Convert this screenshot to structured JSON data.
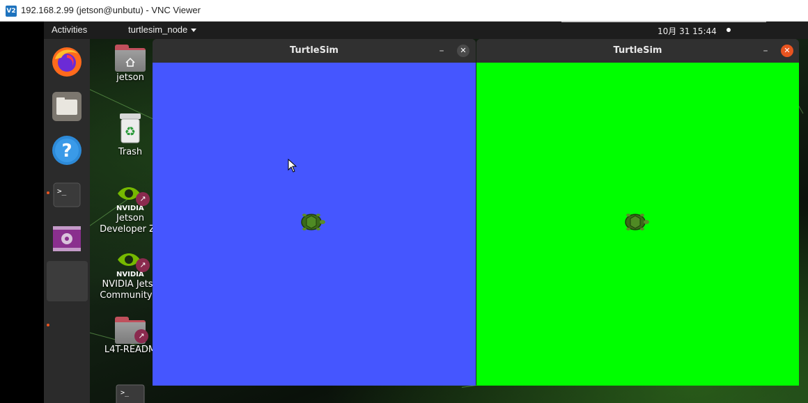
{
  "vnc": {
    "logo_text": "V2",
    "title": "192.168.2.99 (jetson@unbutu) - VNC Viewer"
  },
  "topbar": {
    "activities": "Activities",
    "app_menu": "turtlesim_node",
    "clock": "10月 31  15:44"
  },
  "dock": {
    "items": [
      {
        "name": "firefox-icon"
      },
      {
        "name": "files-icon"
      },
      {
        "name": "help-icon"
      },
      {
        "name": "terminal-icon",
        "glyph": ">_"
      },
      {
        "name": "video-player-icon"
      },
      {
        "name": "active-app-slot"
      }
    ]
  },
  "desktop_icons": [
    {
      "label": "jetson"
    },
    {
      "label": "Trash"
    },
    {
      "label": "Jetson\nDeveloper Zo",
      "line1": "Jetson",
      "line2": "Developer Zo",
      "brand": "NVIDIA"
    },
    {
      "label": "NVIDIA Jetso\nCommunity P",
      "line1": "NVIDIA Jetso",
      "line2": "Community P",
      "brand": "NVIDIA"
    },
    {
      "label": "L4T-READM"
    },
    {
      "glyph": ">_"
    }
  ],
  "windows": [
    {
      "title": "TurtleSim",
      "background": "#4556ff",
      "close_color": "#4a4a4a",
      "minimize": "–",
      "close": "✕"
    },
    {
      "title": "TurtleSim",
      "background": "#00ff00",
      "close_color": "#e95420",
      "minimize": "–",
      "close": "✕"
    }
  ],
  "colors": {
    "accent": "#e95420",
    "sim_blue": "#4556ff",
    "sim_green": "#00ff00"
  }
}
